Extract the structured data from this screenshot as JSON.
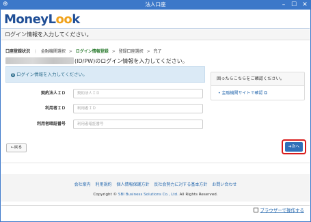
{
  "window": {
    "title": "法人口座",
    "app_icon": "plus-icon"
  },
  "logo": {
    "m": "M",
    "oney": "oney",
    "l": "L",
    "oo": "oo",
    "k": "k"
  },
  "instruction": "ログイン情報を入力してください。",
  "steps": {
    "label": "口座登録状況",
    "items": [
      "金融機関選択",
      "ログイン情報登録",
      "登録口座選択",
      "完了"
    ],
    "active_index": 1
  },
  "heading_suffix": "(ID/PW)のログイン情報を入力してください。",
  "info_message": "ログイン情報を入力してください。",
  "form": {
    "fields": [
      {
        "label": "契約法人ＩＤ",
        "placeholder": "契約法人ＩＤ"
      },
      {
        "label": "利用者ＩＤ",
        "placeholder": "利用者ＩＤ"
      },
      {
        "label": "利用者暗証番号",
        "placeholder": "利用者暗証番号"
      }
    ]
  },
  "help": {
    "title": "困ったらこちらをご確認ください。",
    "link": "金融機関サイトで確認",
    "bullet": "•",
    "ext_icon": "external-link-icon"
  },
  "buttons": {
    "back": "←戻る",
    "next": "➔次へ"
  },
  "footer": {
    "links": [
      "会社案内",
      "利用規約",
      "個人情報保護方針",
      "反社会勢力に対する基本方針",
      "お問い合わせ"
    ],
    "copyright_prefix": "Copyright ©",
    "copyright_company": "SBI Business Solutions Co., Ltd.",
    "copyright_suffix": "All Rights Reserved."
  },
  "statusbar": {
    "browser_link": "ブラウザーで操作する"
  },
  "colors": {
    "titlebar": "#3c78c9",
    "accent": "#2f6fb8",
    "highlight": "#d81b1b",
    "logo_blue": "#1f4e96",
    "logo_orange": "#f0a21b"
  }
}
